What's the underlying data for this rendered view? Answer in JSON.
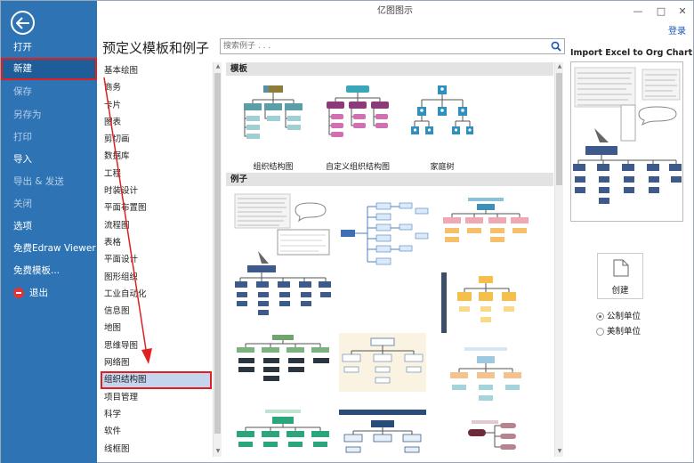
{
  "window": {
    "title": "亿图图示",
    "login": "登录"
  },
  "sidebar": {
    "items": [
      {
        "label": "打开"
      },
      {
        "label": "新建"
      },
      {
        "label": "保存"
      },
      {
        "label": "另存为"
      },
      {
        "label": "打印"
      },
      {
        "label": "导入"
      },
      {
        "label": "导出 & 发送"
      },
      {
        "label": "关闭"
      },
      {
        "label": "选项"
      },
      {
        "label": "免费Edraw Viewer"
      },
      {
        "label": "免费模板..."
      },
      {
        "label": "退出"
      }
    ]
  },
  "main": {
    "title": "预定义模板和例子",
    "search_placeholder": "搜索例子 . . ."
  },
  "categories": [
    "基本绘图",
    "商务",
    "卡片",
    "图表",
    "剪切画",
    "数据库",
    "工程",
    "时装设计",
    "平面布置图",
    "流程图",
    "表格",
    "平面设计",
    "图形组织",
    "工业自动化",
    "信息图",
    "地图",
    "思维导图",
    "网络图",
    "组织结构图",
    "项目管理",
    "科学",
    "软件",
    "线框图"
  ],
  "selected_category": "组织结构图",
  "panel": {
    "templates_header": "模板",
    "examples_header": "例子",
    "templates": [
      {
        "label": "组织结构图"
      },
      {
        "label": "自定义组织结构图"
      },
      {
        "label": "家庭树"
      }
    ]
  },
  "preview": {
    "title": "Import Excel to Org Chart"
  },
  "actions": {
    "create_label": "创建",
    "unit_metric": "公制单位",
    "unit_imperial": "美制单位"
  },
  "colors": {
    "sidebar": "#2e74b5",
    "sidebar_active": "#1f5d99",
    "highlight_border": "#e02020",
    "selected_bg": "#c5d5ee",
    "org_box": "#3d5a8a",
    "link": "#1a56b8"
  }
}
